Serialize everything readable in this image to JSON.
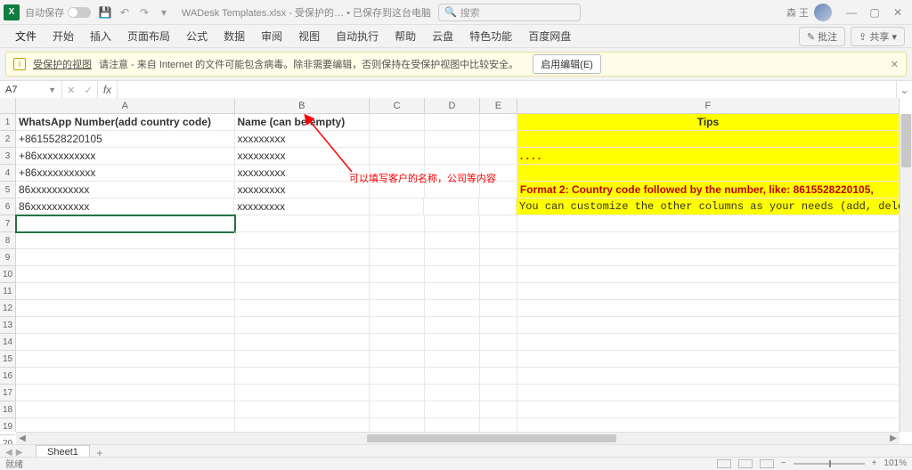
{
  "titlebar": {
    "autosave_label": "自动保存",
    "filename": "WADesk Templates.xlsx - 受保护的… • 已保存到这台电脑 ",
    "search_placeholder": "搜索",
    "username": "森 王"
  },
  "ribbon": {
    "tabs": [
      "文件",
      "开始",
      "插入",
      "页面布局",
      "公式",
      "数据",
      "审阅",
      "视图",
      "自动执行",
      "帮助",
      "云盘",
      "特色功能",
      "百度网盘"
    ],
    "comments": "批注",
    "share": "共享"
  },
  "protect": {
    "title": "受保护的视图",
    "msg": "请注意 - 来自 Internet 的文件可能包含病毒。除非需要编辑，否则保持在受保护视图中比较安全。",
    "enable": "启用编辑(E)"
  },
  "fbar": {
    "namebox": "A7",
    "fx": "fx"
  },
  "cols": {
    "A": "A",
    "B": "B",
    "C": "C",
    "D": "D",
    "E": "E",
    "F": "F"
  },
  "grid": {
    "h_A": "WhatsApp Number(add country code)",
    "h_B": "Name (can be empty)",
    "h_F": "Tips",
    "r2_A": "+8615528220105",
    "r2_B": "xxxxxxxxx",
    "r3_A": "+86xxxxxxxxxxx",
    "r3_B": "xxxxxxxxx",
    "r3_F": ". .                              .                                                .",
    "r4_A": "+86xxxxxxxxxxx",
    "r4_B": "xxxxxxxxx",
    "r5_A": "86xxxxxxxxxxx",
    "r5_B": "xxxxxxxxx",
    "r5_F": "Format 2: Country code followed by the number, like:  8615528220105,",
    "r6_A": "86xxxxxxxxxxx",
    "r6_B": "xxxxxxxxx",
    "r6_F": "You can customize the other columns as your needs (add, delete, modify, e"
  },
  "annotation": "可以填写客户的名称，公司等内容",
  "sheet": {
    "name": "Sheet1"
  },
  "status": {
    "ready": "就绪",
    "zoom": "101%"
  }
}
